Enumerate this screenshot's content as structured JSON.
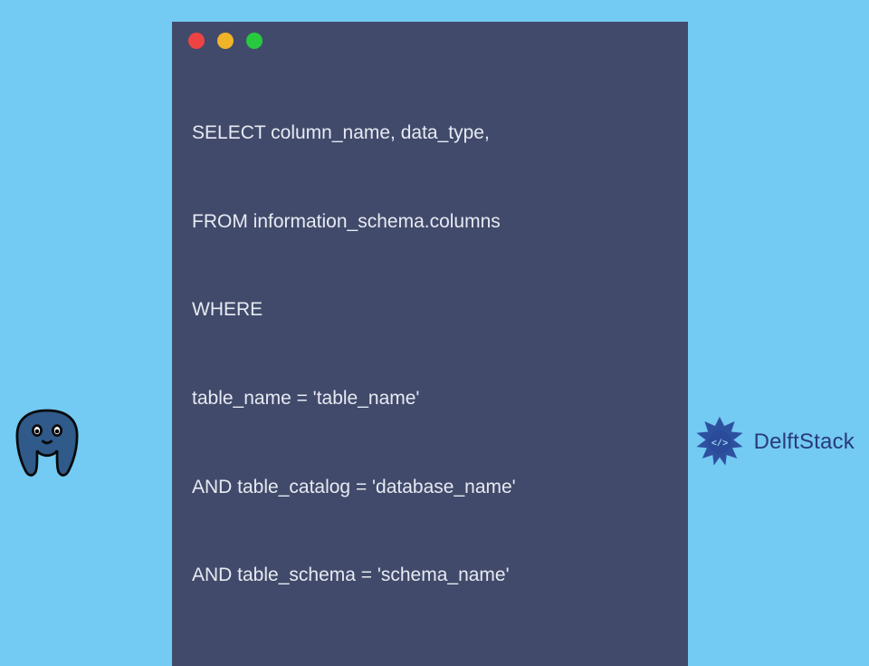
{
  "window": {
    "dots": {
      "red": "#ed4343",
      "yellow": "#f0b429",
      "green": "#27c93f"
    }
  },
  "code": {
    "lines": [
      "SELECT column_name, data_type,",
      "FROM information_schema.columns",
      "WHERE",
      "table_name = 'table_name'",
      "AND table_catalog = 'database_name'",
      "AND table_schema = 'schema_name'"
    ]
  },
  "brand": {
    "name": "DelftStack"
  },
  "icons": {
    "elephant": "postgresql-elephant",
    "brand_badge": "delftstack-badge"
  }
}
